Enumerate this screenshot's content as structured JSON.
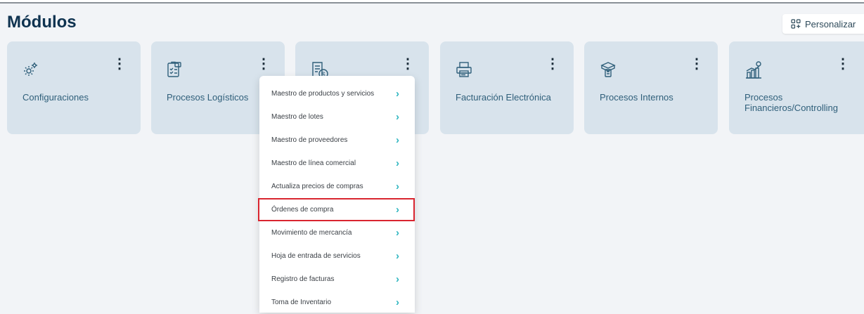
{
  "page": {
    "title": "Módulos",
    "personalize_label": "Personalizar"
  },
  "modules": [
    {
      "label": "Configuraciones",
      "icon": "gears-icon"
    },
    {
      "label": "Procesos Logísticos",
      "icon": "clipboard-box-icon"
    },
    {
      "label": "",
      "icon": "invoice-dollar-icon"
    },
    {
      "label": "Facturación Electrónica",
      "icon": "printer-icon"
    },
    {
      "label": "Procesos Internos",
      "icon": "box-list-icon"
    },
    {
      "label_line1": "Procesos",
      "label_line2": "Financieros/Controlling",
      "icon": "chart-growth-icon"
    }
  ],
  "dropdown": {
    "items": [
      "Maestro de productos y servicios",
      "Maestro de lotes",
      "Maestro de proveedores",
      "Maestro de línea comercial",
      "Actualiza precios de compras",
      "Órdenes de compra",
      "Movimiento de mercancía",
      "Hoja de entrada de servicios",
      "Registro de facturas",
      "Toma de Inventario"
    ],
    "highlighted_item": "Órdenes de compra",
    "highlight_color": "#d9252f",
    "chevron_color": "#2fb6c0"
  }
}
